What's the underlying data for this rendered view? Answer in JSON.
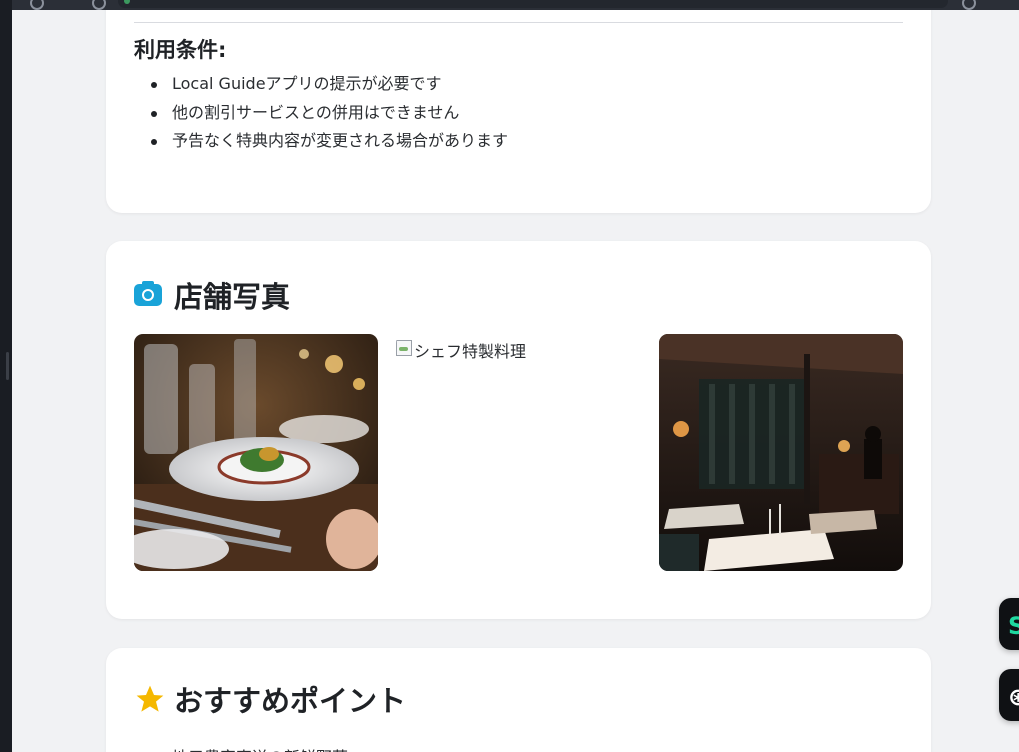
{
  "terms": {
    "title": "利用条件:",
    "items": [
      "Local Guideアプリの提示が必要です",
      "他の割引サービスとの併用はできません",
      "予告なく特典内容が変更される場合があります"
    ]
  },
  "photos_section": {
    "title": "店舗写真",
    "icon": "camera-icon",
    "photos": [
      {
        "alt": "料理写真",
        "broken": false
      },
      {
        "alt": "シェフ特製料理",
        "broken": true
      },
      {
        "alt": "店内写真",
        "broken": false
      }
    ]
  },
  "recommend_section": {
    "title": "おすすめポイント",
    "icon": "star-icon",
    "first_item_partial": "地元農家直送の新鮮野菜"
  },
  "colors": {
    "accent_camera": "#19a3d8",
    "star": "#f5b800",
    "fab_green": "#1fd9a0"
  }
}
